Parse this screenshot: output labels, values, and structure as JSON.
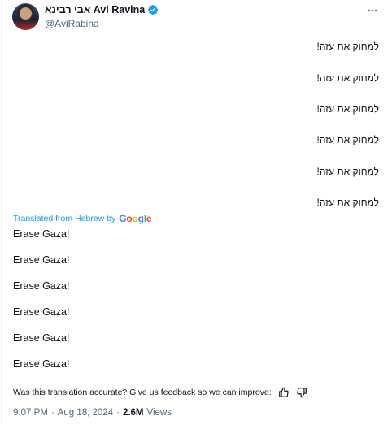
{
  "author": {
    "display_name": "אבי רבינא Avi Ravina",
    "handle": "@AviRabina"
  },
  "tweet": {
    "hebrew_lines": [
      "למחוק את עזה!",
      "למחוק את עזה!",
      "למחוק את עזה!",
      "למחוק את עזה!",
      "למחוק את עזה!",
      "למחוק את עזה!"
    ],
    "translated_label": "Translated from Hebrew by",
    "google_label": "Google",
    "english_lines": [
      "Erase Gaza!",
      "Erase Gaza!",
      "Erase Gaza!",
      "Erase Gaza!",
      "Erase Gaza!",
      "Erase Gaza!"
    ],
    "feedback_text": "Was this translation accurate? Give us feedback so we can improve:",
    "time": "9:07 PM",
    "date": "Aug 18, 2024",
    "views_count": "2.6M",
    "views_label": "Views",
    "separator": "·"
  },
  "colors": {
    "accent": "#1d9bf0",
    "secondary_text": "#536471",
    "primary_text": "#0f1419"
  },
  "icons": {
    "verified": "verified-badge-icon",
    "more": "more-icon",
    "thumbs_up": "thumbs-up-icon",
    "thumbs_down": "thumbs-down-icon"
  }
}
